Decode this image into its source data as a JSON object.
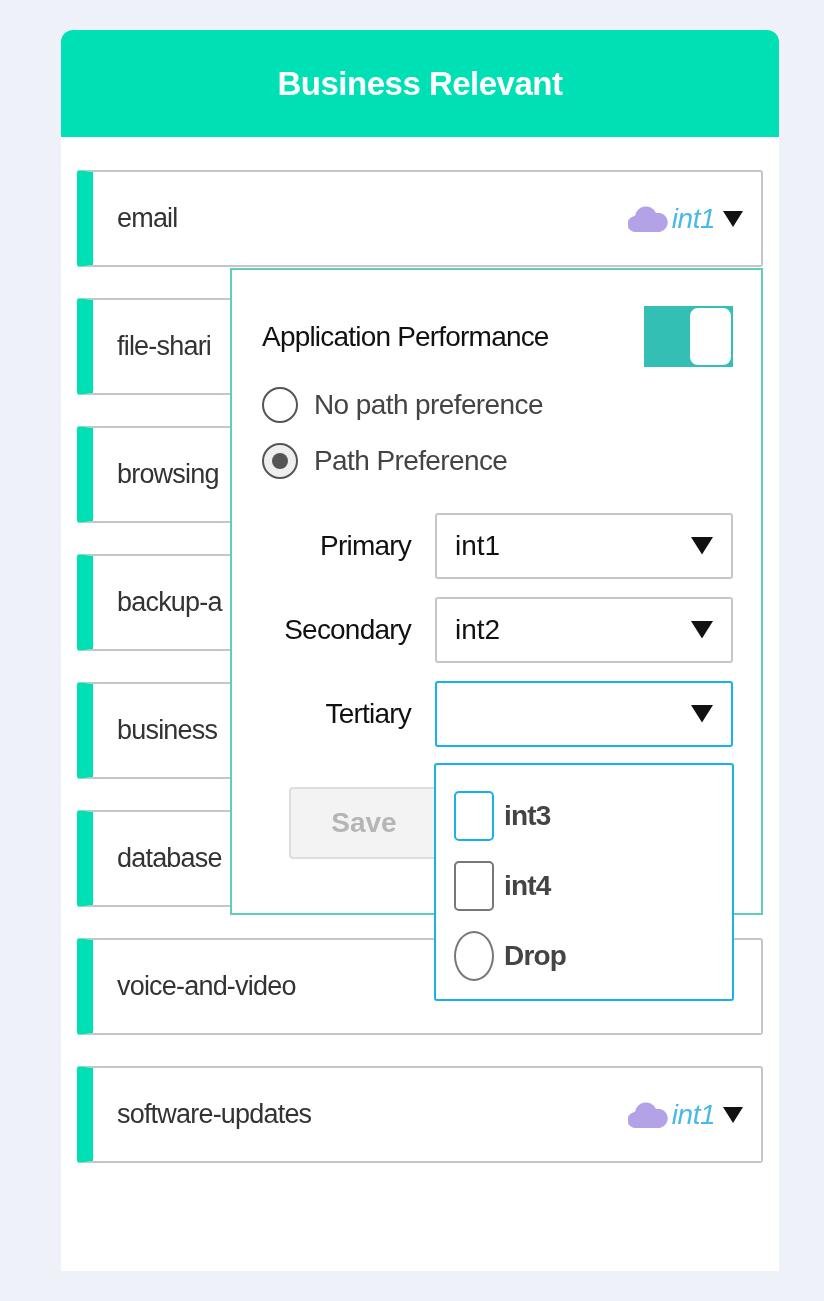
{
  "header": {
    "title": "Business Relevant"
  },
  "rows": [
    {
      "label": "email",
      "interface": "int1"
    },
    {
      "label": "file-shari"
    },
    {
      "label": "browsing"
    },
    {
      "label": "backup-a"
    },
    {
      "label": "business"
    },
    {
      "label": "database"
    },
    {
      "label": "voice-and-video"
    },
    {
      "label": "software-updates",
      "interface": "int1"
    }
  ],
  "popover": {
    "title": "Application Performance",
    "toggle_on": true,
    "options": [
      {
        "label": "No path preference",
        "selected": false
      },
      {
        "label": "Path Preference",
        "selected": true
      }
    ],
    "selects": [
      {
        "label": "Primary",
        "value": "int1",
        "open": false
      },
      {
        "label": "Secondary",
        "value": "int2",
        "open": false
      },
      {
        "label": "Tertiary",
        "open": true
      }
    ],
    "save": {
      "label": "Save",
      "disabled": true
    }
  },
  "dropdown": {
    "items": [
      {
        "kind": "checkbox",
        "label": "int3",
        "checked": false,
        "focused": true
      },
      {
        "kind": "checkbox",
        "label": "int4",
        "checked": false,
        "focused": false
      },
      {
        "kind": "radio",
        "label": "Drop",
        "checked": false,
        "focused": false
      }
    ]
  }
}
